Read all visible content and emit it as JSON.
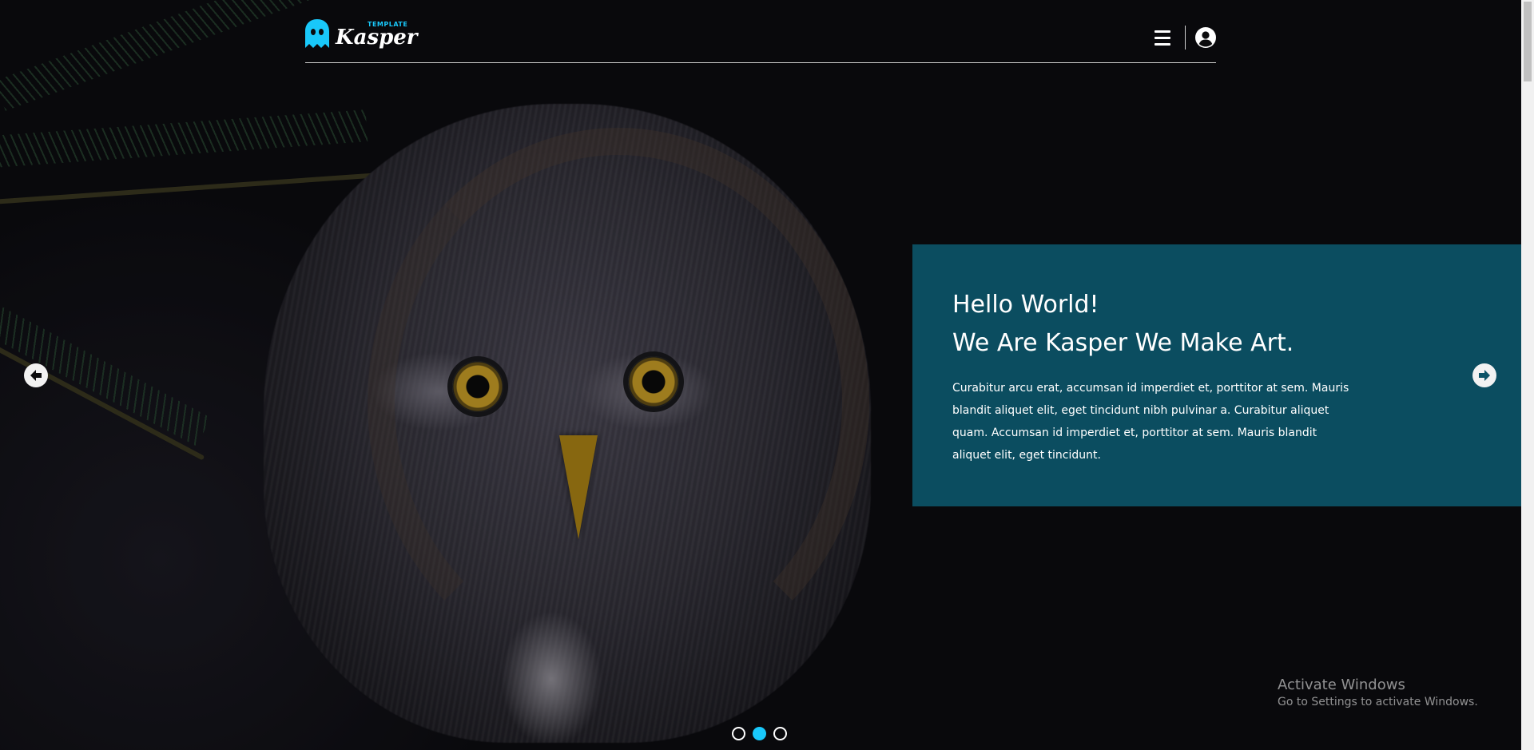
{
  "header": {
    "logo_small_text": "TEMPLATE",
    "logo_name": "Kasper",
    "menu_icon": "hamburger-menu-icon",
    "user_icon": "user-circle-icon"
  },
  "hero": {
    "title_line1": "Hello World!",
    "title_line2": "We Are Kasper We Make Art.",
    "body": "Curabitur arcu erat, accumsan id imperdiet et, porttitor at sem. Mauris blandit aliquet elit, eget tincidunt nibh pulvinar a. Curabitur aliquet quam. Accumsan id imperdiet et, porttitor at sem. Mauris blandit aliquet elit, eget tincidunt."
  },
  "slider": {
    "prev_icon": "arrow-left-circle-icon",
    "next_icon": "arrow-right-circle-icon",
    "slide_count": 3,
    "active_slide": 2
  },
  "watermark": {
    "line1": "Activate Windows",
    "line2": "Go to Settings to activate Windows."
  },
  "colors": {
    "accent": "#19c8fa",
    "panel": "#0c5468",
    "text": "#ffffff"
  }
}
